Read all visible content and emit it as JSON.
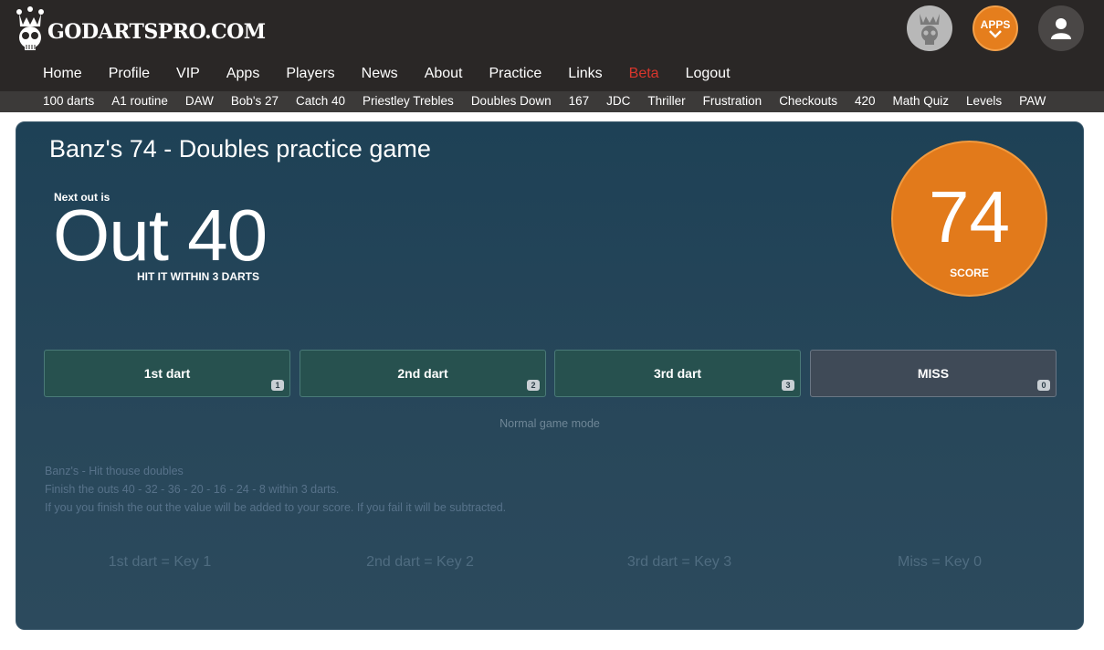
{
  "brand": {
    "name": "GODARTSPRO.COM"
  },
  "top_icons": {
    "apps_label": "APPS"
  },
  "main_nav": [
    "Home",
    "Profile",
    "VIP",
    "Apps",
    "Players",
    "News",
    "About",
    "Practice",
    "Links",
    "Beta",
    "Logout"
  ],
  "sub_nav": [
    "100 darts",
    "A1 routine",
    "DAW",
    "Bob's 27",
    "Catch 40",
    "Priestley Trebles",
    "Doubles Down",
    "167",
    "JDC",
    "Thriller",
    "Frustration",
    "Checkouts",
    "420",
    "Math Quiz",
    "Levels",
    "PAW"
  ],
  "game": {
    "title": "Banz's 74 - Doubles practice game",
    "next_label": "Next out is",
    "out_text": "Out 40",
    "hit_within": "HIT IT WITHIN 3 DARTS",
    "score_value": "74",
    "score_label": "SCORE",
    "buttons": [
      {
        "label": "1st dart",
        "key": "1"
      },
      {
        "label": "2nd dart",
        "key": "2"
      },
      {
        "label": "3rd dart",
        "key": "3"
      },
      {
        "label": "MISS",
        "key": "0"
      }
    ],
    "mode": "Normal game mode",
    "description": [
      "Banz's - Hit thouse doubles",
      "Finish the outs 40 - 32 - 36 - 20 - 16 - 24 - 8 within 3 darts.",
      "If you you finish the out the value will be added to your score. If you fail it will be subtracted."
    ],
    "key_hints": [
      "1st dart = Key 1",
      "2nd dart = Key 2",
      "3rd dart = Key 3",
      "Miss = Key 0"
    ]
  },
  "colors": {
    "accent_orange": "#e27a1b",
    "beta_red": "#d9362c",
    "panel_bg": "#1e4156",
    "topbar_bg": "#2a2726"
  }
}
